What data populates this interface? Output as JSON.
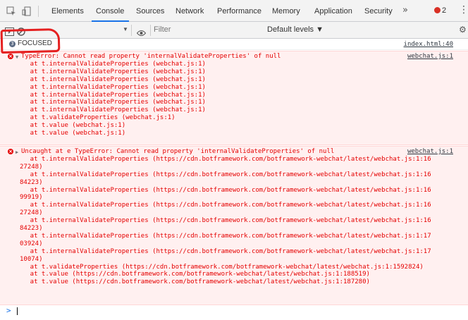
{
  "tabs": [
    {
      "label": "Elements",
      "active": false
    },
    {
      "label": "Console",
      "active": true
    },
    {
      "label": "Sources",
      "active": false
    },
    {
      "label": "Network",
      "active": false
    },
    {
      "label": "Performance",
      "active": false
    },
    {
      "label": "Memory",
      "active": false
    },
    {
      "label": "Application",
      "active": false
    },
    {
      "label": "Security",
      "active": false
    }
  ],
  "more_tabs": "»",
  "error_count": "2",
  "toolbar": {
    "context_dropdown": "▼",
    "filter_placeholder": "Filter",
    "levels": "Default levels ▼"
  },
  "focus_row": {
    "badge": "3",
    "text": "FOCUSED",
    "source": "index.html:40"
  },
  "error1": {
    "source": "webchat.js:1",
    "lines": [
      "TypeError: Cannot read property 'internalValidateProperties' of null",
      "    at t.internalValidateProperties (webchat.js:1)",
      "    at t.internalValidateProperties (webchat.js:1)",
      "    at t.internalValidateProperties (webchat.js:1)",
      "    at t.internalValidateProperties (webchat.js:1)",
      "    at t.internalValidateProperties (webchat.js:1)",
      "    at t.internalValidateProperties (webchat.js:1)",
      "    at t.internalValidateProperties (webchat.js:1)",
      "    at t.validateProperties (webchat.js:1)",
      "    at t.value (webchat.js:1)",
      "    at t.value (webchat.js:1)"
    ]
  },
  "error2": {
    "source": "webchat.js:1",
    "lines": [
      "Uncaught at e TypeError: Cannot read property 'internalValidateProperties' of null",
      "    at t.internalValidateProperties (https://cdn.botframework.com/botframework-webchat/latest/webchat.js:1:16",
      "27248)",
      "    at t.internalValidateProperties (https://cdn.botframework.com/botframework-webchat/latest/webchat.js:1:16",
      "84223)",
      "    at t.internalValidateProperties (https://cdn.botframework.com/botframework-webchat/latest/webchat.js:1:16",
      "99919)",
      "    at t.internalValidateProperties (https://cdn.botframework.com/botframework-webchat/latest/webchat.js:1:16",
      "27248)",
      "    at t.internalValidateProperties (https://cdn.botframework.com/botframework-webchat/latest/webchat.js:1:16",
      "84223)",
      "    at t.internalValidateProperties (https://cdn.botframework.com/botframework-webchat/latest/webchat.js:1:17",
      "03924)",
      "    at t.internalValidateProperties (https://cdn.botframework.com/botframework-webchat/latest/webchat.js:1:17",
      "10074)",
      "    at t.validateProperties (https://cdn.botframework.com/botframework-webchat/latest/webchat.js:1:1592824)",
      "    at t.value (https://cdn.botframework.com/botframework-webchat/latest/webchat.js:1:188519)",
      "    at t.value (https://cdn.botframework.com/botframework-webchat/latest/webchat.js:1:187280)"
    ]
  },
  "prompt": ">",
  "colors": {
    "error_text": "#e50000",
    "error_bg": "#fff0f0",
    "accent": "#1a73e8",
    "annotation": "#e52020"
  }
}
